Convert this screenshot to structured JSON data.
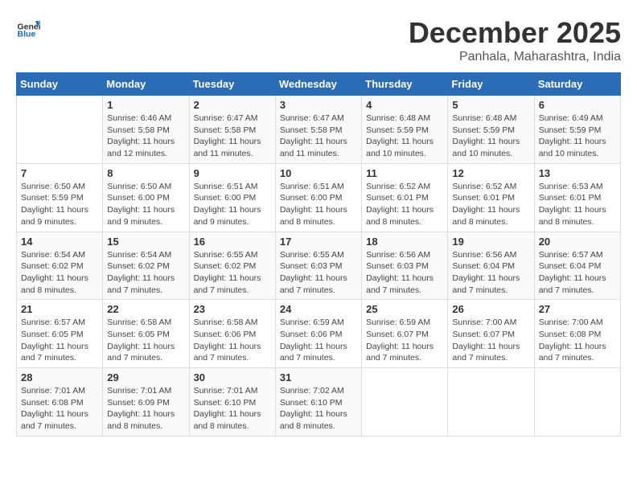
{
  "header": {
    "logo_general": "General",
    "logo_blue": "Blue",
    "month_year": "December 2025",
    "location": "Panhala, Maharashtra, India"
  },
  "calendar": {
    "days_of_week": [
      "Sunday",
      "Monday",
      "Tuesday",
      "Wednesday",
      "Thursday",
      "Friday",
      "Saturday"
    ],
    "weeks": [
      [
        {
          "day": "",
          "info": ""
        },
        {
          "day": "1",
          "info": "Sunrise: 6:46 AM\nSunset: 5:58 PM\nDaylight: 11 hours\nand 12 minutes."
        },
        {
          "day": "2",
          "info": "Sunrise: 6:47 AM\nSunset: 5:58 PM\nDaylight: 11 hours\nand 11 minutes."
        },
        {
          "day": "3",
          "info": "Sunrise: 6:47 AM\nSunset: 5:58 PM\nDaylight: 11 hours\nand 11 minutes."
        },
        {
          "day": "4",
          "info": "Sunrise: 6:48 AM\nSunset: 5:59 PM\nDaylight: 11 hours\nand 10 minutes."
        },
        {
          "day": "5",
          "info": "Sunrise: 6:48 AM\nSunset: 5:59 PM\nDaylight: 11 hours\nand 10 minutes."
        },
        {
          "day": "6",
          "info": "Sunrise: 6:49 AM\nSunset: 5:59 PM\nDaylight: 11 hours\nand 10 minutes."
        }
      ],
      [
        {
          "day": "7",
          "info": "Sunrise: 6:50 AM\nSunset: 5:59 PM\nDaylight: 11 hours\nand 9 minutes."
        },
        {
          "day": "8",
          "info": "Sunrise: 6:50 AM\nSunset: 6:00 PM\nDaylight: 11 hours\nand 9 minutes."
        },
        {
          "day": "9",
          "info": "Sunrise: 6:51 AM\nSunset: 6:00 PM\nDaylight: 11 hours\nand 9 minutes."
        },
        {
          "day": "10",
          "info": "Sunrise: 6:51 AM\nSunset: 6:00 PM\nDaylight: 11 hours\nand 8 minutes."
        },
        {
          "day": "11",
          "info": "Sunrise: 6:52 AM\nSunset: 6:01 PM\nDaylight: 11 hours\nand 8 minutes."
        },
        {
          "day": "12",
          "info": "Sunrise: 6:52 AM\nSunset: 6:01 PM\nDaylight: 11 hours\nand 8 minutes."
        },
        {
          "day": "13",
          "info": "Sunrise: 6:53 AM\nSunset: 6:01 PM\nDaylight: 11 hours\nand 8 minutes."
        }
      ],
      [
        {
          "day": "14",
          "info": "Sunrise: 6:54 AM\nSunset: 6:02 PM\nDaylight: 11 hours\nand 8 minutes."
        },
        {
          "day": "15",
          "info": "Sunrise: 6:54 AM\nSunset: 6:02 PM\nDaylight: 11 hours\nand 7 minutes."
        },
        {
          "day": "16",
          "info": "Sunrise: 6:55 AM\nSunset: 6:02 PM\nDaylight: 11 hours\nand 7 minutes."
        },
        {
          "day": "17",
          "info": "Sunrise: 6:55 AM\nSunset: 6:03 PM\nDaylight: 11 hours\nand 7 minutes."
        },
        {
          "day": "18",
          "info": "Sunrise: 6:56 AM\nSunset: 6:03 PM\nDaylight: 11 hours\nand 7 minutes."
        },
        {
          "day": "19",
          "info": "Sunrise: 6:56 AM\nSunset: 6:04 PM\nDaylight: 11 hours\nand 7 minutes."
        },
        {
          "day": "20",
          "info": "Sunrise: 6:57 AM\nSunset: 6:04 PM\nDaylight: 11 hours\nand 7 minutes."
        }
      ],
      [
        {
          "day": "21",
          "info": "Sunrise: 6:57 AM\nSunset: 6:05 PM\nDaylight: 11 hours\nand 7 minutes."
        },
        {
          "day": "22",
          "info": "Sunrise: 6:58 AM\nSunset: 6:05 PM\nDaylight: 11 hours\nand 7 minutes."
        },
        {
          "day": "23",
          "info": "Sunrise: 6:58 AM\nSunset: 6:06 PM\nDaylight: 11 hours\nand 7 minutes."
        },
        {
          "day": "24",
          "info": "Sunrise: 6:59 AM\nSunset: 6:06 PM\nDaylight: 11 hours\nand 7 minutes."
        },
        {
          "day": "25",
          "info": "Sunrise: 6:59 AM\nSunset: 6:07 PM\nDaylight: 11 hours\nand 7 minutes."
        },
        {
          "day": "26",
          "info": "Sunrise: 7:00 AM\nSunset: 6:07 PM\nDaylight: 11 hours\nand 7 minutes."
        },
        {
          "day": "27",
          "info": "Sunrise: 7:00 AM\nSunset: 6:08 PM\nDaylight: 11 hours\nand 7 minutes."
        }
      ],
      [
        {
          "day": "28",
          "info": "Sunrise: 7:01 AM\nSunset: 6:08 PM\nDaylight: 11 hours\nand 7 minutes."
        },
        {
          "day": "29",
          "info": "Sunrise: 7:01 AM\nSunset: 6:09 PM\nDaylight: 11 hours\nand 8 minutes."
        },
        {
          "day": "30",
          "info": "Sunrise: 7:01 AM\nSunset: 6:10 PM\nDaylight: 11 hours\nand 8 minutes."
        },
        {
          "day": "31",
          "info": "Sunrise: 7:02 AM\nSunset: 6:10 PM\nDaylight: 11 hours\nand 8 minutes."
        },
        {
          "day": "",
          "info": ""
        },
        {
          "day": "",
          "info": ""
        },
        {
          "day": "",
          "info": ""
        }
      ]
    ]
  }
}
